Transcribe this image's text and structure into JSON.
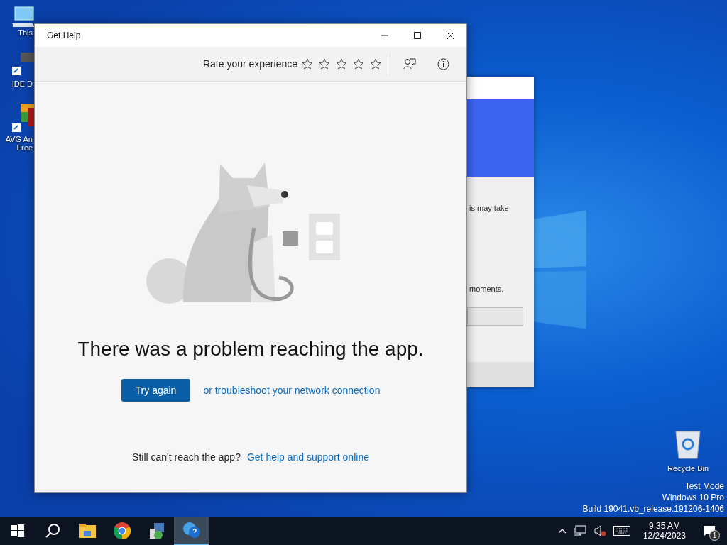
{
  "desktop_icons": [
    {
      "kind": "pc",
      "label": "This"
    },
    {
      "kind": "chip",
      "label": "IDE D"
    },
    {
      "kind": "avg",
      "label": "AVG An",
      "label_2": "Free"
    }
  ],
  "recycle_bin": {
    "label": "Recycle Bin"
  },
  "watermark": [
    "Test Mode",
    "Windows 10 Pro",
    "Build 19041.vb_release.191206-1406"
  ],
  "back_window": {
    "texts": [
      "is may take",
      "moments."
    ]
  },
  "window": {
    "title": "Get Help",
    "rate_label": "Rate your experience",
    "stars": 0,
    "heading": "There was a problem reaching the app.",
    "try_again": "Try again",
    "troubleshoot_link": "or troubleshoot your network connection",
    "footer_text": "Still can't reach the app?",
    "footer_link": "Get help and support online"
  },
  "taskbar": {
    "items": [
      {
        "kind": "start",
        "selected": false
      },
      {
        "kind": "search",
        "selected": false
      },
      {
        "kind": "folder",
        "selected": false
      },
      {
        "kind": "chrome",
        "selected": false
      },
      {
        "kind": "installer",
        "selected": false
      },
      {
        "kind": "help",
        "selected": true
      }
    ],
    "time": "9:35 AM",
    "date": "12/24/2023",
    "notifications": "1"
  }
}
